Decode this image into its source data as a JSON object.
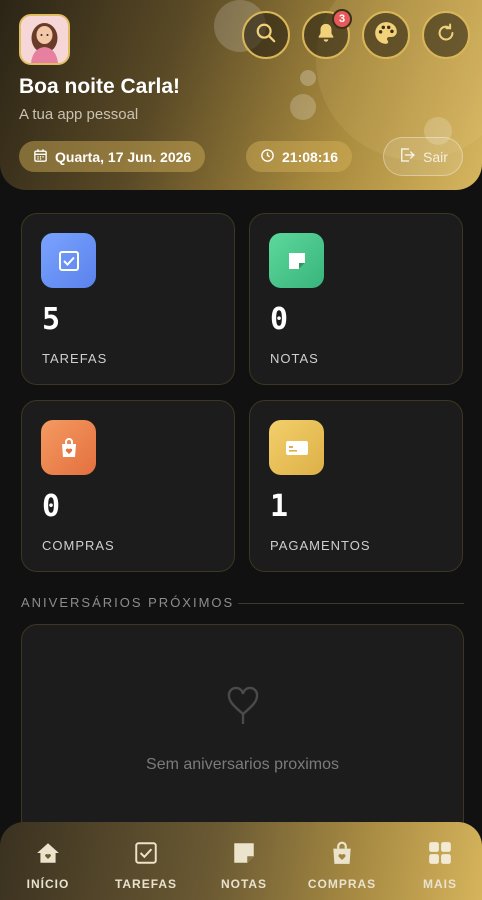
{
  "header": {
    "greeting": "Boa noite Carla!",
    "subtitle": "A tua app pessoal",
    "date": "Quarta, 17 Jun. 2026",
    "time": "21:08:16",
    "logout_label": "Sair",
    "notification_count": "3",
    "icons": [
      "search-icon",
      "bell-icon",
      "palette-icon",
      "refresh-icon"
    ]
  },
  "stats": [
    {
      "value": "5",
      "label": "TAREFAS",
      "icon": "checkbox-icon",
      "color": "#6d95f7"
    },
    {
      "value": "0",
      "label": "NOTAS",
      "icon": "sticky-note-icon",
      "color": "#45c98c"
    },
    {
      "value": "0",
      "label": "COMPRAS",
      "icon": "shopping-bag-icon",
      "color": "#ef8550"
    },
    {
      "value": "1",
      "label": "PAGAMENTOS",
      "icon": "credit-card-icon",
      "color": "#e8bd53"
    }
  ],
  "birthdays": {
    "title": "ANIVERSÁRIOS PRÓXIMOS",
    "empty_text": "Sem aniversarios proximos"
  },
  "nav": [
    {
      "label": "INÍCIO",
      "icon": "home-icon"
    },
    {
      "label": "TAREFAS",
      "icon": "checkbox-icon"
    },
    {
      "label": "NOTAS",
      "icon": "sticky-note-icon"
    },
    {
      "label": "COMPRAS",
      "icon": "shopping-bag-icon"
    },
    {
      "label": "MAIS",
      "icon": "grid-icon"
    }
  ]
}
